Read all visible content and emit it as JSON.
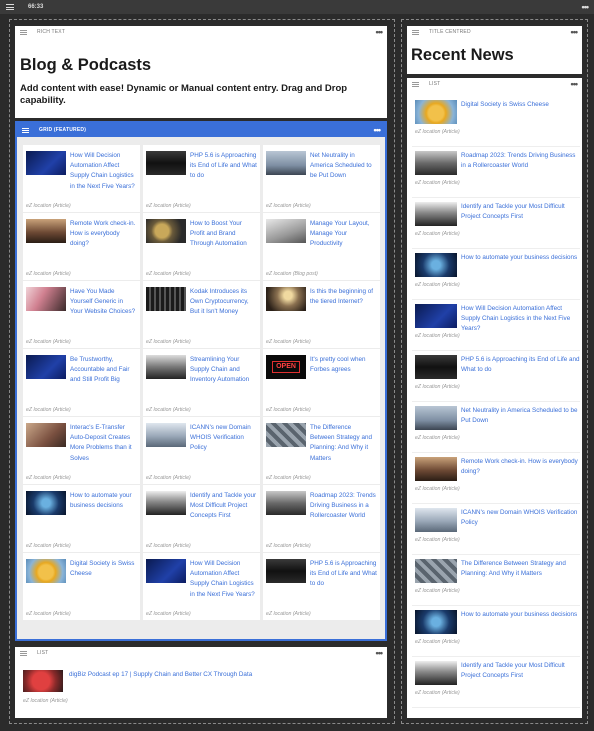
{
  "topbar": {
    "ratio": "66:33"
  },
  "rich_text": {
    "tag": "RICH TEXT",
    "title": "Blog & Podcasts",
    "body": "Add content with ease! Dynamic or Manual content entry. Drag and Drop capability."
  },
  "grid": {
    "tag": "GRID (FEATURED)",
    "items": [
      {
        "title": "How Will Decision Automation Affect Supply Chain Logistics in the Next Five Years?",
        "loc": "eZ location (Article)",
        "thumb": "th-blue"
      },
      {
        "title": "PHP 5.6 is Approaching its End of Life and What to do",
        "loc": "eZ location (Article)",
        "thumb": "th-dark"
      },
      {
        "title": "Net Neutrality in America Scheduled to be Put Down",
        "loc": "eZ location (Article)",
        "thumb": "th-sky"
      },
      {
        "title": "Remote Work check-in. How is everybody doing?",
        "loc": "eZ location (Article)",
        "thumb": "th-sunset"
      },
      {
        "title": "How to Boost Your Profit and Brand Through Automation",
        "loc": "eZ location (Article)",
        "thumb": "th-gears"
      },
      {
        "title": "Manage Your Layout, Manage Your Productivity",
        "loc": "eZ location (Blog post)",
        "thumb": "th-road"
      },
      {
        "title": "Have You Made Yourself Generic in Your Website Choices?",
        "loc": "eZ location (Article)",
        "thumb": "th-pink"
      },
      {
        "title": "Kodak Introduces its Own Cryptocurrency, But it Isn't Money",
        "loc": "eZ location (Article)",
        "thumb": "th-keys"
      },
      {
        "title": "Is this the beginning of the tiered Internet?",
        "loc": "eZ location (Article)",
        "thumb": "th-light"
      },
      {
        "title": "Be Trustworthy, Accountable and Fair and Still Profit Big",
        "loc": "eZ location (Article)",
        "thumb": "th-blue"
      },
      {
        "title": "Streamlining Your Supply Chain and Inventory Automation",
        "loc": "eZ location (Article)",
        "thumb": "th-bw"
      },
      {
        "title": "It's pretty cool when Forbes agrees",
        "loc": "eZ location (Article)",
        "thumb": "th-open"
      },
      {
        "title": "Interac's E-Transfer Auto-Deposit Creates More Problems than it Solves",
        "loc": "eZ location (Article)",
        "thumb": "th-money"
      },
      {
        "title": "ICANN's new Domain WHOIS Verification Policy",
        "loc": "eZ location (Article)",
        "thumb": "th-person"
      },
      {
        "title": "The Difference Between Strategy and Planning: And Why it Matters",
        "loc": "eZ location (Article)",
        "thumb": "th-metal"
      },
      {
        "title": "How to automate your business decisions",
        "loc": "eZ location (Article)",
        "thumb": "th-drops"
      },
      {
        "title": "Identify and Tackle your Most Difficult Project Concepts First",
        "loc": "eZ location (Article)",
        "thumb": "th-suit"
      },
      {
        "title": "Roadmap 2023: Trends Driving Business in a Rollercoaster World",
        "loc": "eZ location (Article)",
        "thumb": "th-train"
      },
      {
        "title": "Digital Society is Swiss Cheese",
        "loc": "eZ location (Article)",
        "thumb": "th-cheese"
      },
      {
        "title": "How Will Decision Automation Affect Supply Chain Logistics in the Next Five Years?",
        "loc": "eZ location (Article)",
        "thumb": "th-blue"
      },
      {
        "title": "PHP 5.6 is Approaching its End of Life and What to do",
        "loc": "eZ location (Article)",
        "thumb": "th-dark"
      }
    ],
    "open_sign": "OPEN"
  },
  "list_left": {
    "tag": "LIST",
    "items": [
      {
        "title": "digBiz Podcast ep 17 | Supply Chain and Better CX Through Data",
        "loc": "eZ location (Article)",
        "thumb": "th-podcast"
      }
    ]
  },
  "title_block": {
    "tag": "TITLE CENTRED",
    "title": "Recent News"
  },
  "list_right": {
    "tag": "LIST",
    "items": [
      {
        "title": "Digital Society is Swiss Cheese",
        "loc": "eZ location (Article)",
        "thumb": "th-cheese"
      },
      {
        "title": "Roadmap 2023: Trends Driving Business in a Rollercoaster World",
        "loc": "eZ location (Article)",
        "thumb": "th-train"
      },
      {
        "title": "Identify and Tackle your Most Difficult Project Concepts First",
        "loc": "eZ location (Article)",
        "thumb": "th-suit"
      },
      {
        "title": "How to automate your business decisions",
        "loc": "eZ location (Article)",
        "thumb": "th-drops"
      },
      {
        "title": "How Will Decision Automation Affect Supply Chain Logistics in the Next Five Years?",
        "loc": "eZ location (Article)",
        "thumb": "th-blue"
      },
      {
        "title": "PHP 5.6 is Approaching its End of Life and What to do",
        "loc": "eZ location (Article)",
        "thumb": "th-dark"
      },
      {
        "title": "Net Neutrality in America Scheduled to be Put Down",
        "loc": "eZ location (Article)",
        "thumb": "th-sky"
      },
      {
        "title": "Remote Work check-in. How is everybody doing?",
        "loc": "eZ location (Article)",
        "thumb": "th-sunset"
      },
      {
        "title": "ICANN's new Domain WHOIS Verification Policy",
        "loc": "eZ location (Article)",
        "thumb": "th-person"
      },
      {
        "title": "The Difference Between Strategy and Planning: And Why it Matters",
        "loc": "eZ location (Article)",
        "thumb": "th-metal"
      },
      {
        "title": "How to automate your business decisions",
        "loc": "eZ location (Article)",
        "thumb": "th-drops"
      },
      {
        "title": "Identify and Tackle your Most Difficult Project Concepts First",
        "loc": "eZ location (Article)",
        "thumb": "th-suit"
      }
    ]
  }
}
